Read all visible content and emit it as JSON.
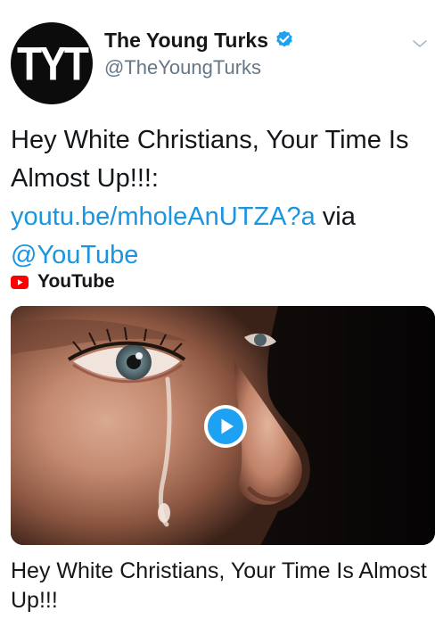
{
  "user": {
    "avatar_text": "TYT",
    "display_name": "The Young Turks",
    "handle": "@TheYoungTurks",
    "verified": true
  },
  "tweet": {
    "text_before_link": "Hey White Christians, Your Time Is Almost Up!!!: ",
    "link_text": "youtu.be/mholeAnUTZA?a",
    "text_via": " via ",
    "mention": "@YouTube"
  },
  "card": {
    "source_label": "YouTube",
    "title": "Hey White Christians, Your Time Is Almost Up!!!"
  },
  "icons": {
    "verified": "verified-badge-icon",
    "menu": "chevron-down-icon",
    "source": "youtube-icon",
    "media": "play-icon"
  },
  "colors": {
    "link": "#1b95e0",
    "verified": "#1da1f2",
    "youtube_red": "#ff0000",
    "secondary_text": "#657786"
  }
}
